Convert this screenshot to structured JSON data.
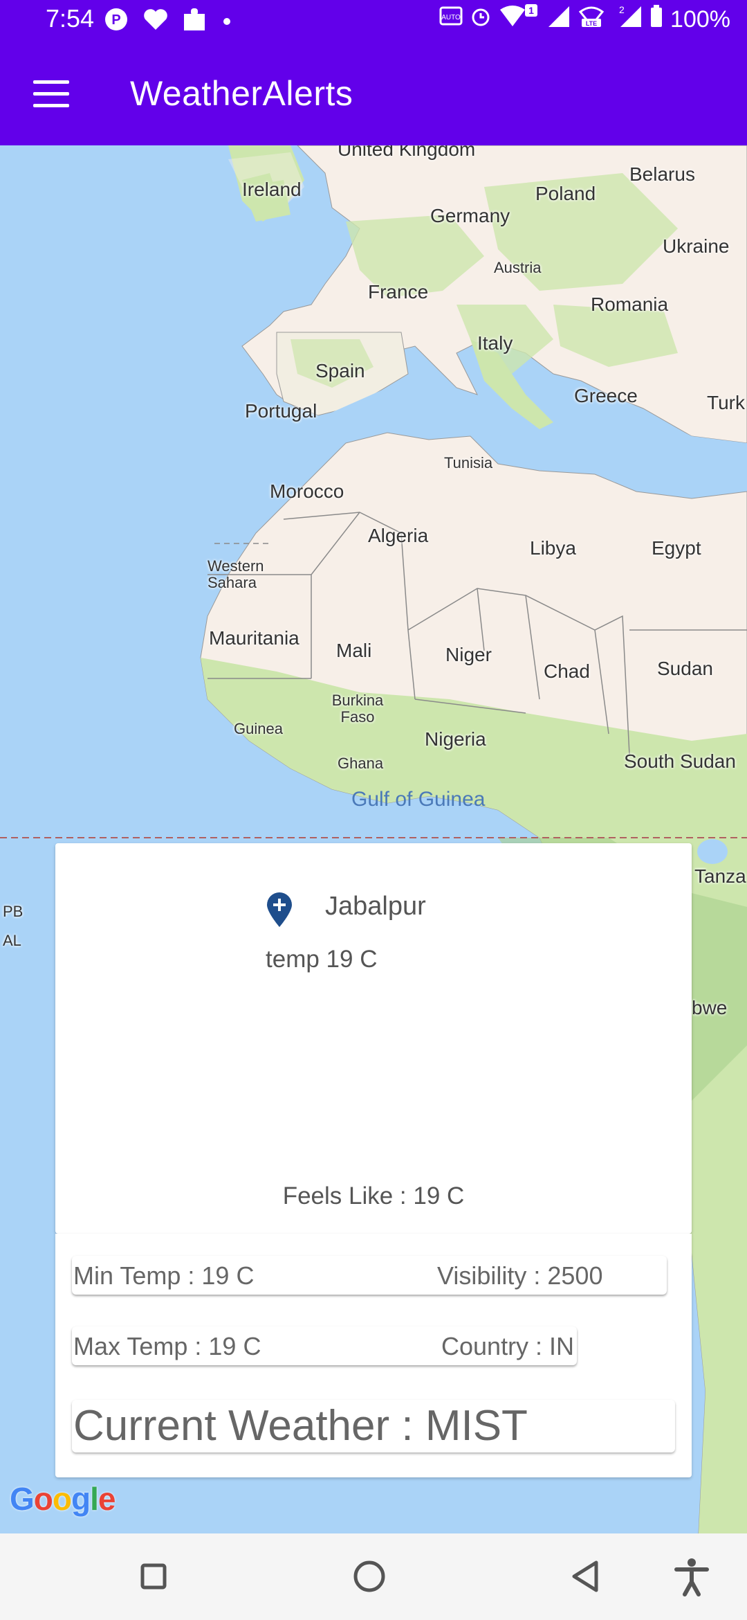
{
  "status_bar": {
    "time": "7:54",
    "battery": "100%",
    "sim1_badge": "1",
    "sim2_badge": "2",
    "icons": [
      "p-icon",
      "heart-icon",
      "puzzle-icon",
      "dot-icon",
      "auto-icon",
      "alarm-icon",
      "wifi-icon",
      "signal-icon",
      "volte-icon",
      "signal-icon",
      "battery-icon"
    ]
  },
  "app_bar": {
    "title": "WeatherAlerts",
    "menu_icon": "hamburger-menu-icon"
  },
  "map": {
    "labels": [
      "United Kingdom",
      "Ireland",
      "Belarus",
      "Poland",
      "Germany",
      "Ukraine",
      "Austria",
      "France",
      "Romania",
      "Italy",
      "Spain",
      "Portugal",
      "Greece",
      "Turk",
      "Tunisia",
      "Morocco",
      "Algeria",
      "Libya",
      "Egypt",
      "Western Sahara",
      "Mauritania",
      "Mali",
      "Niger",
      "Chad",
      "Sudan",
      "Burkina Faso",
      "Guinea",
      "Nigeria",
      "Ghana",
      "South Sudan",
      "Gulf of Guinea",
      "Tanza",
      "bwe",
      "PB",
      "AL"
    ],
    "attribution": "Google",
    "colors": {
      "water": "#aad3f7",
      "land": "#f7efe8",
      "vegetation": "#cde6ad"
    }
  },
  "weather_card": {
    "pin_icon": "location-pin-add-icon",
    "city": "Jabalpur",
    "temp": "temp 19 C",
    "feels_like": "Feels Like : 19 C"
  },
  "details": {
    "min_temp": "Min Temp : 19 C",
    "visibility": "Visibility : 2500",
    "max_temp": "Max Temp : 19 C",
    "country": "Country : IN",
    "current_weather": "Current Weather : MIST"
  },
  "nav_bar": {
    "buttons": [
      "recents-square-icon",
      "home-circle-icon",
      "back-triangle-icon",
      "accessibility-icon"
    ]
  },
  "colors": {
    "primary": "#6200ea",
    "text": "#666666",
    "pin": "#1f4e8c"
  }
}
